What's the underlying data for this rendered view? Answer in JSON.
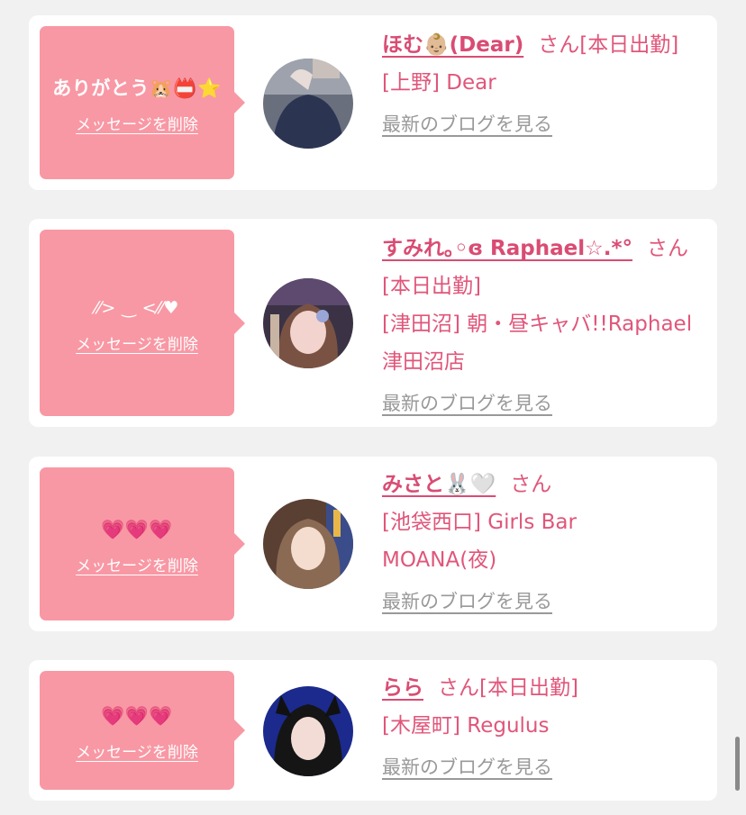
{
  "messages": [
    {
      "bubble_text": "ありがとう🐹📛⭐",
      "delete_label": "メッセージを削除",
      "name": "ほむ👶🏼(Dear)",
      "suffix": "さん[本日出勤]",
      "shop": "[上野] Dear",
      "blog_link": "最新のブログを見る",
      "avatar_icon": "avatar-photo"
    },
    {
      "bubble_text": "⁄⁄> ‿ <⁄⁄♥",
      "delete_label": "メッセージを削除",
      "name": "すみれ｡◦ɞ Raphael☆.*°",
      "suffix": "さん[本日出勤]",
      "shop": "[津田沼] 朝・昼キャバ!!Raphael 津田沼店",
      "blog_link": "最新のブログを見る",
      "avatar_icon": "avatar-photo"
    },
    {
      "bubble_text": "💗💗💗",
      "delete_label": "メッセージを削除",
      "name": "みさと🐰🤍",
      "suffix": "さん",
      "shop": "[池袋西口] Girls Bar MOANA(夜)",
      "blog_link": "最新のブログを見る",
      "avatar_icon": "avatar-photo"
    },
    {
      "bubble_text": "💗💗💗",
      "delete_label": "メッセージを削除",
      "name": "らら",
      "suffix": "さん[本日出勤]",
      "shop": "[木屋町] Regulus",
      "blog_link": "最新のブログを見る",
      "avatar_icon": "avatar-photo"
    }
  ],
  "colors": {
    "page_background": "#f1f1f1",
    "card_background": "#ffffff",
    "bubble_pink": "#f898a4",
    "name_pink": "#d94c73",
    "text_pink": "#e0567a",
    "link_gray": "#999999"
  }
}
